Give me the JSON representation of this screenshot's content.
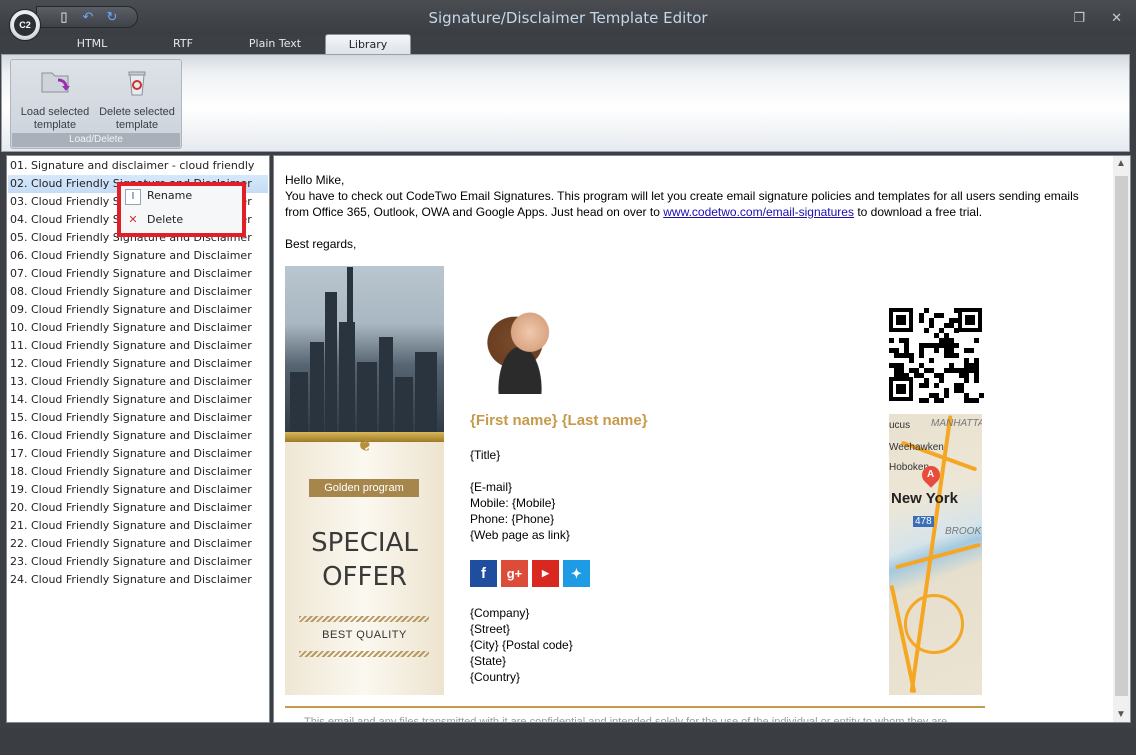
{
  "window": {
    "title": "Signature/Disclaimer Template Editor",
    "app_badge": "C2",
    "minimize_icon": "restore-icon",
    "close_icon": "close-icon"
  },
  "tabs": [
    {
      "label": "HTML",
      "active": false
    },
    {
      "label": "RTF",
      "active": false
    },
    {
      "label": "Plain Text",
      "active": false
    },
    {
      "label": "Library",
      "active": true
    }
  ],
  "ribbon": {
    "group_label": "Load/Delete",
    "load_label": "Load selected template",
    "delete_label": "Delete selected template"
  },
  "templates": [
    "01. Signature and disclaimer - cloud friendly",
    "02. Cloud Friendly Signature and Disclaimer",
    "03. Cloud Friendly Signature and Disclaimer",
    "04. Cloud Friendly Signature and Disclaimer",
    "05. Cloud Friendly Signature and Disclaimer",
    "06. Cloud Friendly Signature and Disclaimer",
    "07. Cloud Friendly Signature and Disclaimer",
    "08. Cloud Friendly Signature and Disclaimer",
    "09. Cloud Friendly Signature and Disclaimer",
    "10. Cloud Friendly Signature and Disclaimer",
    "11. Cloud Friendly Signature and Disclaimer",
    "12. Cloud Friendly Signature and Disclaimer",
    "13. Cloud Friendly Signature and Disclaimer",
    "14. Cloud Friendly Signature and Disclaimer",
    "15. Cloud Friendly Signature and Disclaimer",
    "16. Cloud Friendly Signature and Disclaimer",
    "17. Cloud Friendly Signature and Disclaimer",
    "18. Cloud Friendly Signature and Disclaimer",
    "19. Cloud Friendly Signature and Disclaimer",
    "20. Cloud Friendly Signature and Disclaimer",
    "21. Cloud Friendly Signature and Disclaimer",
    "22. Cloud Friendly Signature and Disclaimer",
    "23. Cloud Friendly Signature and Disclaimer",
    "24. Cloud Friendly Signature and Disclaimer"
  ],
  "selected_index": 1,
  "context_menu": {
    "rename": "Rename",
    "delete": "Delete"
  },
  "email": {
    "greeting": "Hello Mike,",
    "body_1": "You have to check out CodeTwo Email Signatures. This program will let you create email signature policies and templates for all users sending emails from Office 365, Outlook, OWA and Google Apps. Just head on over to",
    "link": "www.codetwo.com/email-signatures",
    "body_2": "to download a free trial.",
    "closing": "Best regards,",
    "banner_badge": "Golden program",
    "banner_title_1": "SPECIAL",
    "banner_title_2": "OFFER",
    "banner_footer": "BEST QUALITY",
    "name": "{First name} {Last name}",
    "title": "{Title}",
    "email": "{E-mail}",
    "mobile": "Mobile: {Mobile}",
    "phone": "Phone: {Phone}",
    "web": "{Web page as link}",
    "company": "{Company}",
    "street": "{Street}",
    "city": "{City} {Postal code}",
    "state": "{State}",
    "country": "{Country}",
    "map_labels": {
      "ucus": "ucus",
      "manhattan": "MANHATTA",
      "weehawken": "Weehawken",
      "hoboken": "Hoboken",
      "newyork": "New York",
      "route": "478",
      "brook": "BROOK",
      "pin": "A"
    },
    "footer_disclaimer": "This email and any files transmitted with it are confidential and intended solely for the use of the individual or entity to whom they are"
  },
  "colors": {
    "accent_gold": "#c69a4a",
    "highlight": "#e21f26",
    "link": "#1a0dab"
  }
}
